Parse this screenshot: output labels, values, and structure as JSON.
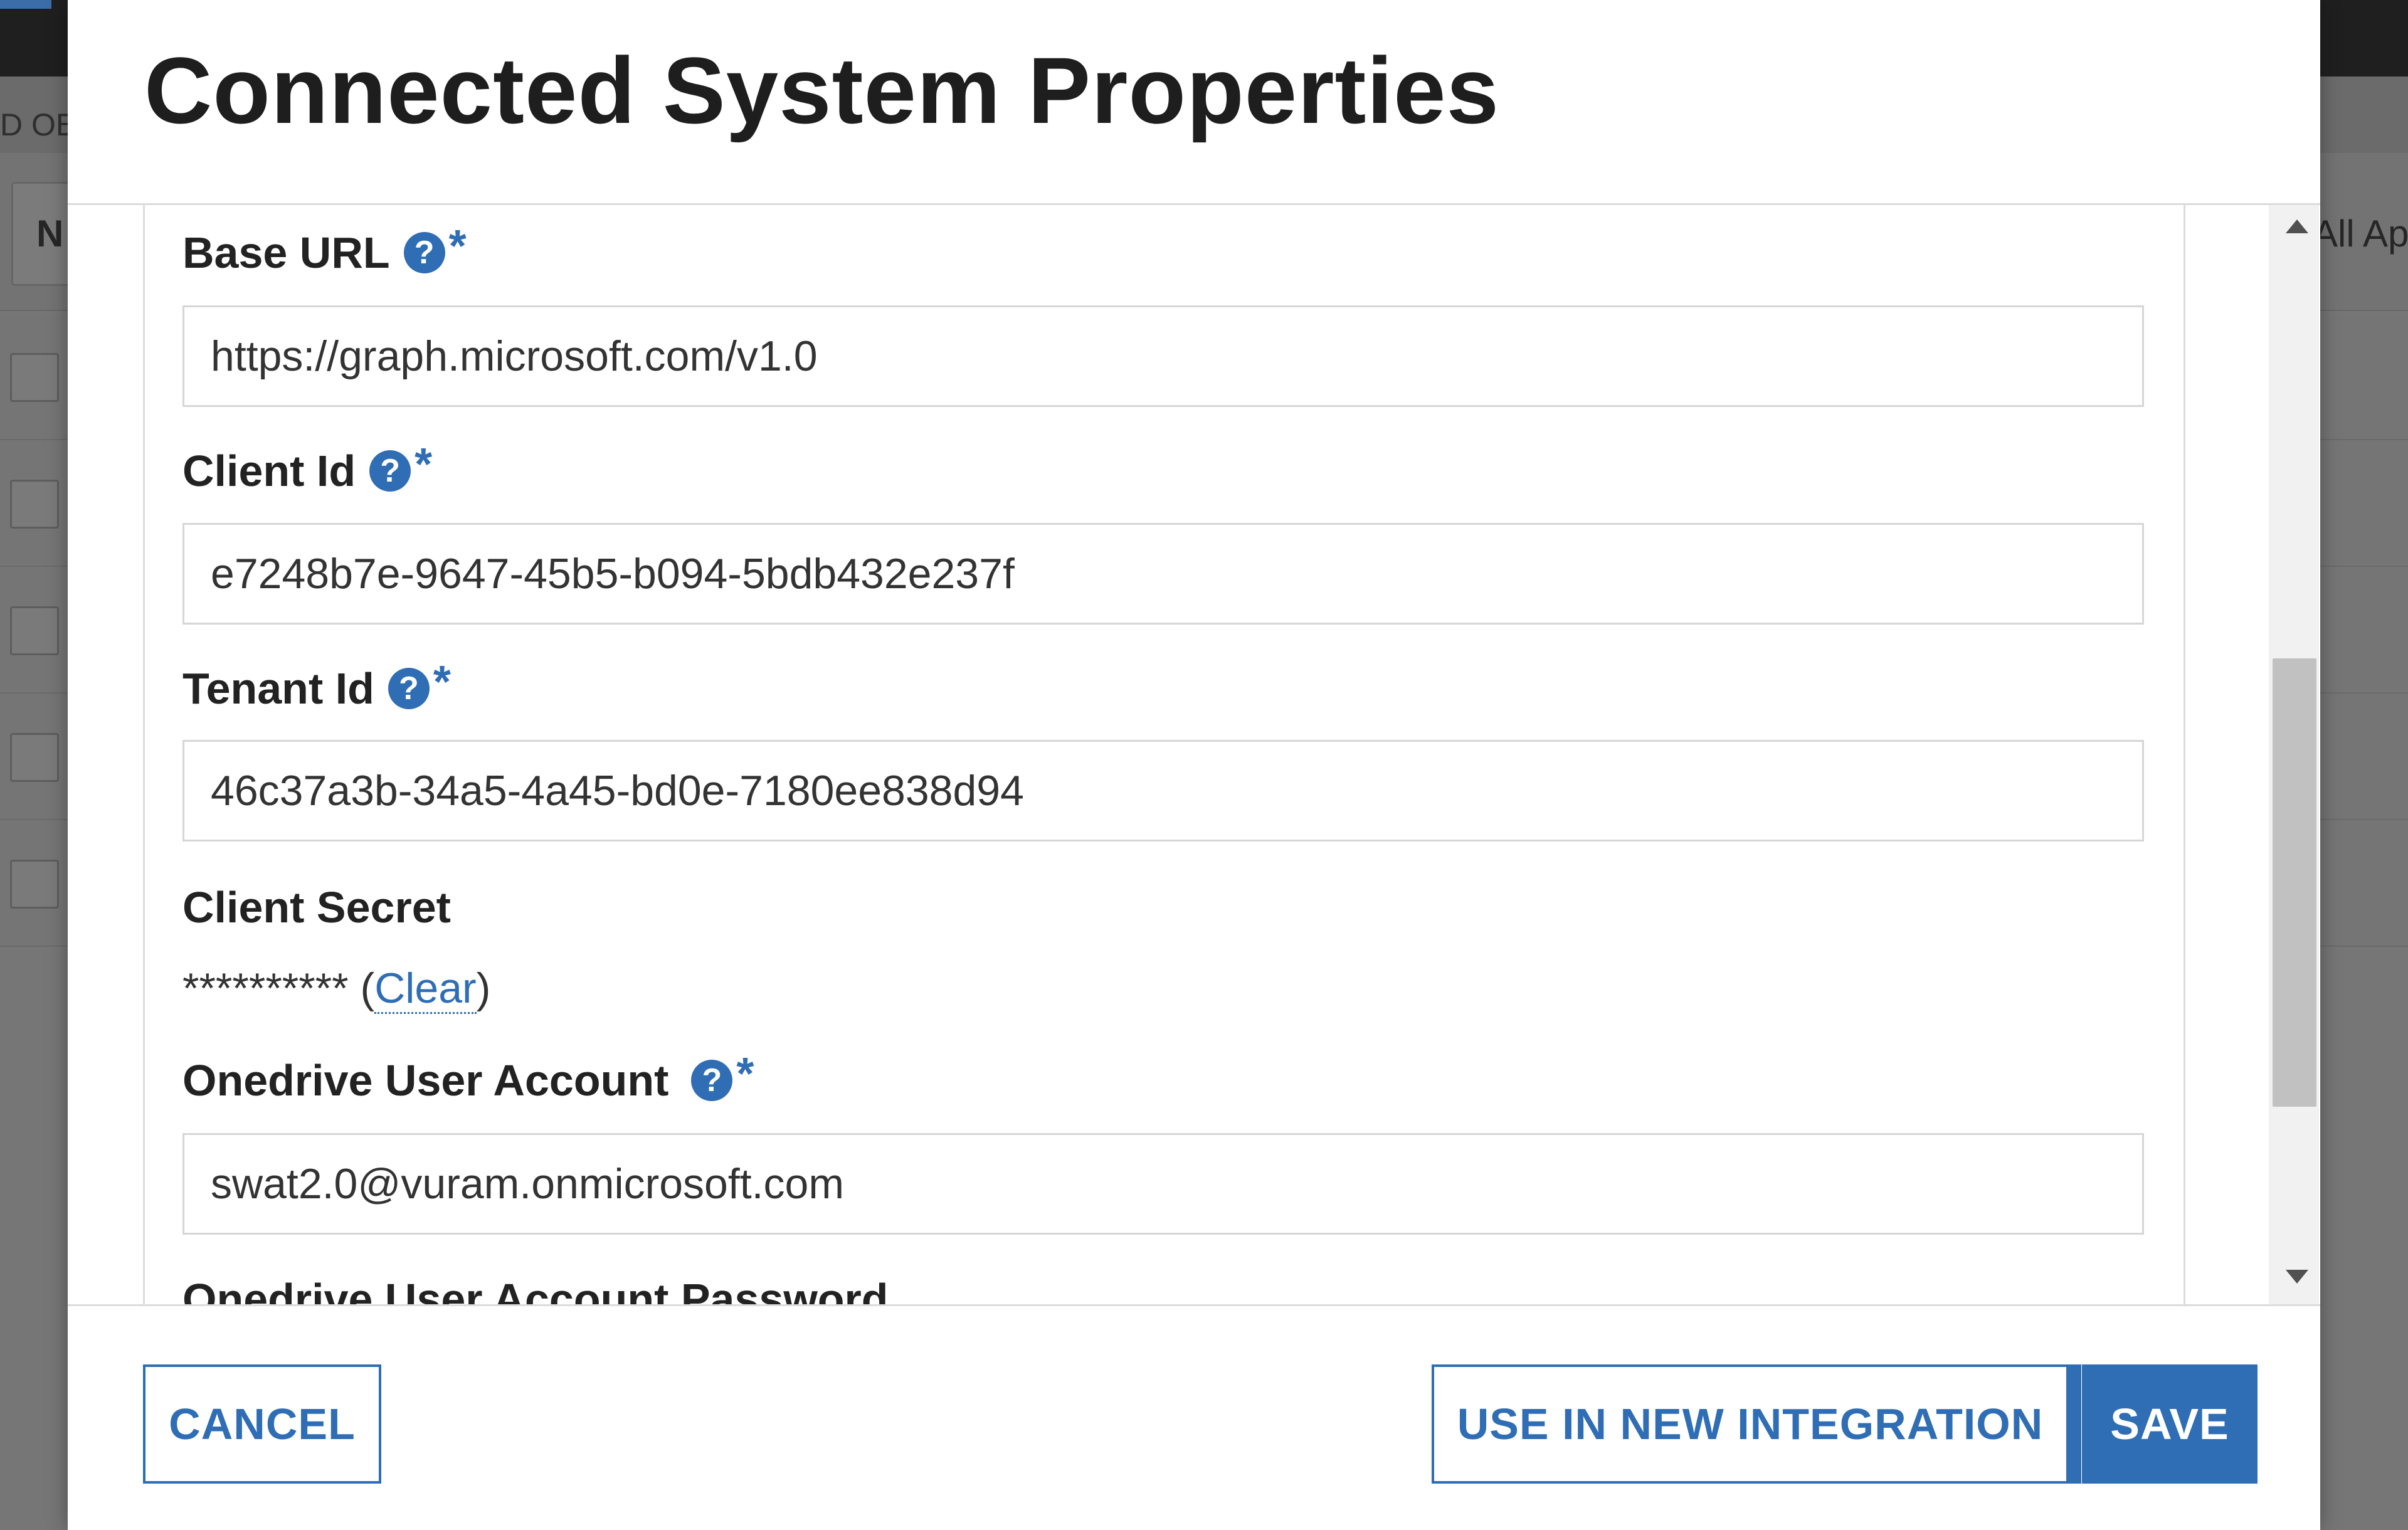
{
  "background": {
    "subbar_text": "D OB",
    "filter_left_text": "N",
    "filter_right_text": "All Ap"
  },
  "modal": {
    "title": "Connected System Properties"
  },
  "fields": {
    "base_url": {
      "label": "Base URL",
      "value": "https://graph.microsoft.com/v1.0",
      "required_mark": "*"
    },
    "client_id": {
      "label": "Client Id",
      "value": "e7248b7e-9647-45b5-b094-5bdb432e237f",
      "required_mark": "*"
    },
    "tenant_id": {
      "label": "Tenant Id",
      "value": "46c37a3b-34a5-4a45-bd0e-7180ee838d94",
      "required_mark": "*"
    },
    "client_secret": {
      "label": "Client Secret",
      "masked_value": "**********",
      "open_paren": " (",
      "clear_link": "Clear",
      "close_paren": ")"
    },
    "onedrive_user_account": {
      "label": "Onedrive User Account",
      "value": "swat2.0@vuram.onmicrosoft.com",
      "required_mark": "*"
    },
    "onedrive_user_account_password": {
      "label": "Onedrive User Account Password"
    }
  },
  "help_icon_glyph": "?",
  "icons": {
    "help": "question-circle-icon",
    "scroll_up": "triangle-up-icon",
    "scroll_down": "triangle-down-icon"
  },
  "footer": {
    "cancel_label": "CANCEL",
    "use_in_integration_label": "USE IN NEW INTEGRATION",
    "save_label": "SAVE"
  },
  "colors": {
    "accent": "#2f6db5",
    "overlay": "#767676",
    "modal_bg": "#ffffff"
  }
}
